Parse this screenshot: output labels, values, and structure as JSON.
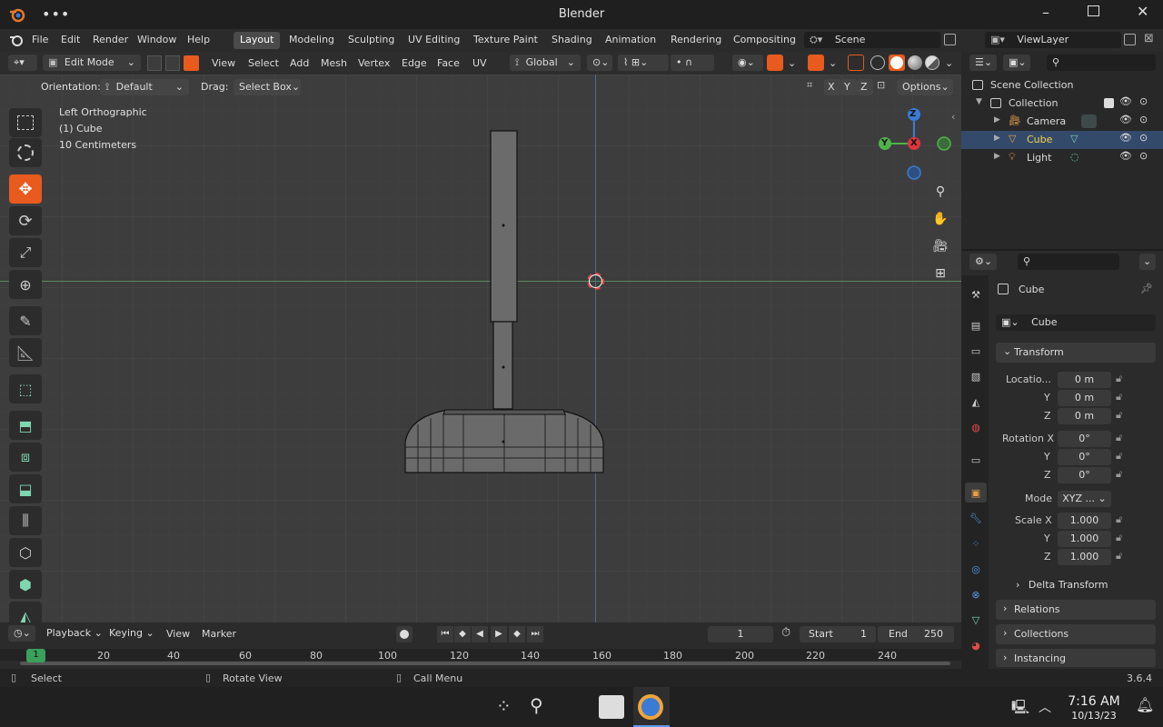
{
  "window": {
    "title": "Blender"
  },
  "menu": {
    "items": [
      "File",
      "Edit",
      "Render",
      "Window",
      "Help"
    ]
  },
  "workspaces": [
    "Layout",
    "Modeling",
    "Sculpting",
    "UV Editing",
    "Texture Paint",
    "Shading",
    "Animation",
    "Rendering",
    "Compositing"
  ],
  "active_workspace": "Layout",
  "scene": {
    "name": "Scene",
    "view_layer": "ViewLayer"
  },
  "header": {
    "mode": "Edit Mode",
    "menus": [
      "View",
      "Select",
      "Add",
      "Mesh",
      "Vertex",
      "Edge",
      "Face",
      "UV"
    ],
    "transform_orientation": "Global",
    "orientation_label": "Orientation:",
    "orientation_value": "Default",
    "drag_label": "Drag:",
    "drag_value": "Select Box",
    "options": "Options",
    "axis": [
      "X",
      "Y",
      "Z"
    ]
  },
  "viewport": {
    "view_name": "Left Orthographic",
    "object_label": "(1) Cube",
    "scale_label": "10 Centimeters",
    "gizmo_axes": [
      "Z",
      "Y",
      "X"
    ]
  },
  "outliner": {
    "root": "Scene Collection",
    "collection": "Collection",
    "items": [
      {
        "name": "Camera",
        "icon": "camera-icon"
      },
      {
        "name": "Cube",
        "icon": "mesh-icon",
        "selected": true
      },
      {
        "name": "Light",
        "icon": "light-icon"
      }
    ]
  },
  "properties": {
    "object_name": "Cube",
    "data_name": "Cube",
    "transform_title": "Transform",
    "location": {
      "label": "Locatio...",
      "x": "0 m",
      "y": "0 m",
      "z": "0 m"
    },
    "rotation": {
      "label": "Rotation X",
      "x": "0°",
      "y": "0°",
      "z": "0°"
    },
    "mode_label": "Mode",
    "mode_value": "XYZ ...",
    "scale": {
      "label": "Scale X",
      "x": "1.000",
      "y": "1.000",
      "z": "1.000"
    },
    "axis_y": "Y",
    "axis_z": "Z",
    "delta_transform": "Delta Transform",
    "panels": [
      "Relations",
      "Collections",
      "Instancing"
    ]
  },
  "timeline": {
    "menus": [
      "Playback",
      "Keying",
      "View",
      "Marker"
    ],
    "current_frame": "1",
    "start_label": "Start",
    "start": "1",
    "end_label": "End",
    "end": "250",
    "ticks": [
      "1",
      "20",
      "40",
      "60",
      "80",
      "100",
      "120",
      "140",
      "160",
      "180",
      "200",
      "220",
      "240"
    ]
  },
  "status": {
    "select": "Select",
    "rotate": "Rotate View",
    "call_menu": "Call Menu",
    "version": "3.6.4"
  },
  "taskbar": {
    "time": "7:16 AM",
    "date": "10/13/23"
  },
  "colors": {
    "accent": "#e85a1d",
    "selected_text": "#f5d24a",
    "x_axis": "#e0343f",
    "y_axis": "#4fb34a",
    "z_axis": "#3a7bd5"
  }
}
